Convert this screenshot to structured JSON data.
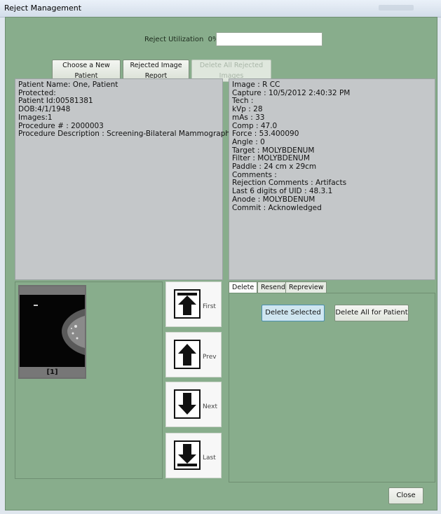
{
  "window": {
    "title": "Reject Management"
  },
  "utilization": {
    "label": "Reject Utilization",
    "percent_text": "0%",
    "value": 0
  },
  "toolbar": {
    "choose_patient": "Choose a New  Patient",
    "rejected_report": "Rejected Image Report",
    "delete_all_rejected": "Delete All Rejected Images"
  },
  "patient_info": [
    "Patient Name: One, Patient",
    "Protected:",
    "Patient Id:00581381",
    "DOB:4/1/1948",
    "Images:1",
    "Procedure # : 2000003",
    "Procedure Description : Screening-Bilateral Mammography"
  ],
  "image_info": [
    "Image : R CC",
    "Capture : 10/5/2012 2:40:32 PM",
    "Tech :",
    "kVp : 28",
    "mAs : 33",
    "Comp : 47.0",
    "Force : 53.400090",
    "Angle : 0",
    "Target : MOLYBDENUM",
    "Filter : MOLYBDENUM",
    "Paddle : 24 cm x 29cm",
    "Comments :",
    "Rejection Comments : Artifacts",
    "Last 6 digits of UID : 48.3.1",
    "Anode : MOLYBDENUM",
    "Commit : Acknowledged"
  ],
  "thumbnail": {
    "label": "[1]"
  },
  "nav": {
    "first": "First",
    "prev": "Prev",
    "next": "Next",
    "last": "Last"
  },
  "tabs": [
    "Delete",
    "Resend",
    "Repreview"
  ],
  "actions": {
    "delete_selected": "Delete Selected",
    "delete_all_patient": "Delete All for Patient"
  },
  "footer": {
    "close": "Close"
  },
  "colors": {
    "background": "#88ad8c",
    "panel": "#c4c7c9",
    "accent_button": "#cfe6f0"
  }
}
